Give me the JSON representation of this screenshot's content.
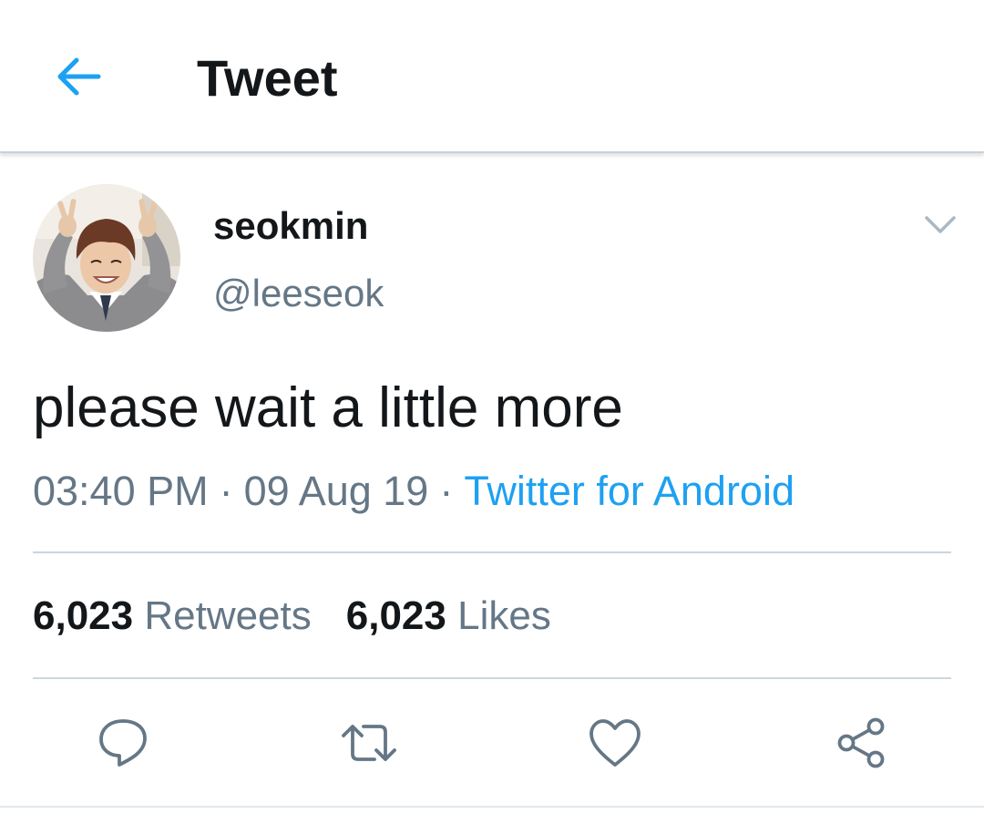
{
  "header": {
    "back_icon": "arrow-left-icon",
    "title": "Tweet"
  },
  "colors": {
    "accent": "#1da1f2",
    "text_primary": "#14171a",
    "text_secondary": "#657786",
    "divider": "#ccd6dd"
  },
  "tweet": {
    "display_name": "seokmin",
    "handle": "@leeseok",
    "menu_icon": "chevron-down-icon",
    "text": "please wait a little more",
    "time": "03:40 PM",
    "date": "09 Aug 19",
    "separator": "·",
    "source": "Twitter for Android"
  },
  "stats": {
    "retweets_count": "6,023",
    "retweets_label": "Retweets",
    "likes_count": "6,023",
    "likes_label": "Likes"
  },
  "actions": [
    {
      "icon": "reply-icon"
    },
    {
      "icon": "retweet-icon"
    },
    {
      "icon": "heart-icon"
    },
    {
      "icon": "share-icon"
    }
  ]
}
